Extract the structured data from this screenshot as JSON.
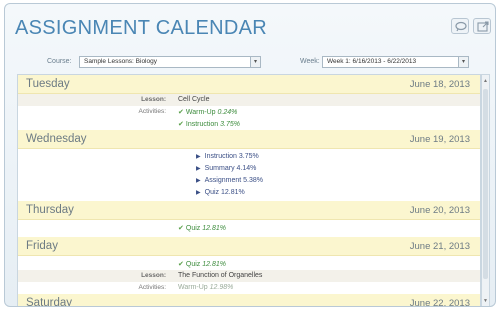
{
  "window": {
    "title": "ASSIGNMENT CALENDAR"
  },
  "titlebar_icons": [
    "comment-icon",
    "export-icon"
  ],
  "toolbar": {
    "course_label": "Course:",
    "course_value": "Sample Lessons: Biology",
    "week_label": "Week:",
    "week_value": "Week 1: 6/16/2013 - 6/22/2013"
  },
  "labels": {
    "lesson": "Lesson:",
    "activities": "Activities:"
  },
  "days": [
    {
      "name": "Tuesday",
      "date": "June 18, 2013",
      "lesson": "Cell Cycle",
      "activities": [
        {
          "name": "Warm-Up",
          "pct": "0.24%"
        },
        {
          "name": "Instruction",
          "pct": "3.75%"
        }
      ]
    },
    {
      "name": "Wednesday",
      "date": "June 19, 2013",
      "items": [
        {
          "name": "Instruction",
          "pct": "3.75%"
        },
        {
          "name": "Summary",
          "pct": "4.14%"
        },
        {
          "name": "Assignment",
          "pct": "5.38%"
        },
        {
          "name": "Quiz",
          "pct": "12.81%"
        }
      ]
    },
    {
      "name": "Thursday",
      "date": "June 20, 2013",
      "activities": [
        {
          "name": "Quiz",
          "pct": "12.81%"
        }
      ]
    },
    {
      "name": "Friday",
      "date": "June 21, 2013",
      "activities": [
        {
          "name": "Quiz",
          "pct": "12.81%"
        }
      ],
      "lesson": "The Function of Organelles",
      "activities2": [
        {
          "name": "Warm-Up",
          "pct": "12.98%"
        }
      ]
    },
    {
      "name": "Saturday",
      "date": "June 22, 2013"
    }
  ],
  "colors": {
    "title": "#4a86b4",
    "day_band": "#fbf6cf",
    "check": "#5aa04a",
    "todo": "#3b4f86"
  }
}
